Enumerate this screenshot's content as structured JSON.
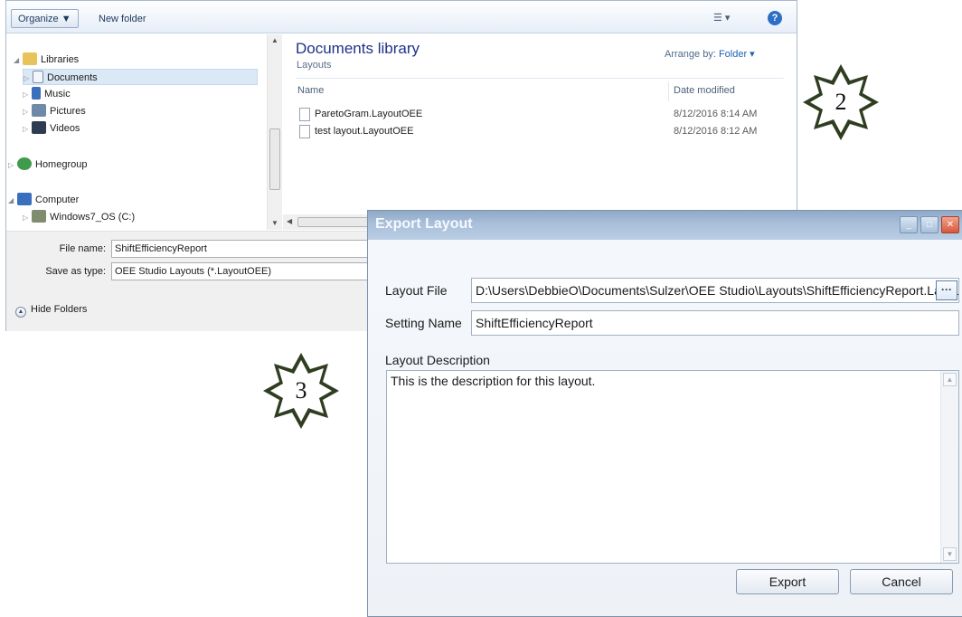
{
  "save_dialog": {
    "toolbar": {
      "organize_label": "Organize ▼",
      "new_folder_label": "New folder",
      "view_glyph": "☰ ▾",
      "help_glyph": "?"
    },
    "nav": {
      "libraries": "Libraries",
      "documents": "Documents",
      "music": "Music",
      "pictures": "Pictures",
      "videos": "Videos",
      "homegroup": "Homegroup",
      "computer": "Computer",
      "drive": "Windows7_OS (C:)"
    },
    "content": {
      "title": "Documents library",
      "subtitle": "Layouts",
      "arrange_by_label": "Arrange by:",
      "arrange_by_value": "Folder ▾",
      "col_name": "Name",
      "col_date": "Date modified",
      "files": [
        {
          "name": "ParetoGram.LayoutOEE",
          "date": "8/12/2016 8:14 AM"
        },
        {
          "name": "test layout.LayoutOEE",
          "date": "8/12/2016 8:12 AM"
        }
      ]
    },
    "file_name_label": "File name:",
    "file_name_value": "ShiftEfficiencyReport",
    "save_as_label": "Save as type:",
    "save_as_value": "OEE Studio Layouts (*.LayoutOEE)",
    "hide_folders": "Hide Folders"
  },
  "badges": {
    "two": "2",
    "three": "3"
  },
  "export_dialog": {
    "title": "Export Layout",
    "layout_file_label": "Layout File",
    "layout_file_value": "D:\\Users\\DebbieO\\Documents\\Sulzer\\OEE Studio\\Layouts\\ShiftEfficiencyReport.LayoutOEE",
    "browse_label": "···",
    "setting_name_label": "Setting Name",
    "setting_name_value": "ShiftEfficiencyReport",
    "description_label": "Layout Description",
    "description_value": "This is the description for this layout.",
    "export_label": "Export",
    "cancel_label": "Cancel"
  },
  "colors": {
    "badge_fill": "#2f3d20",
    "title_blue": "#1e3287",
    "dialog_title_bar": "#a9bfda"
  }
}
